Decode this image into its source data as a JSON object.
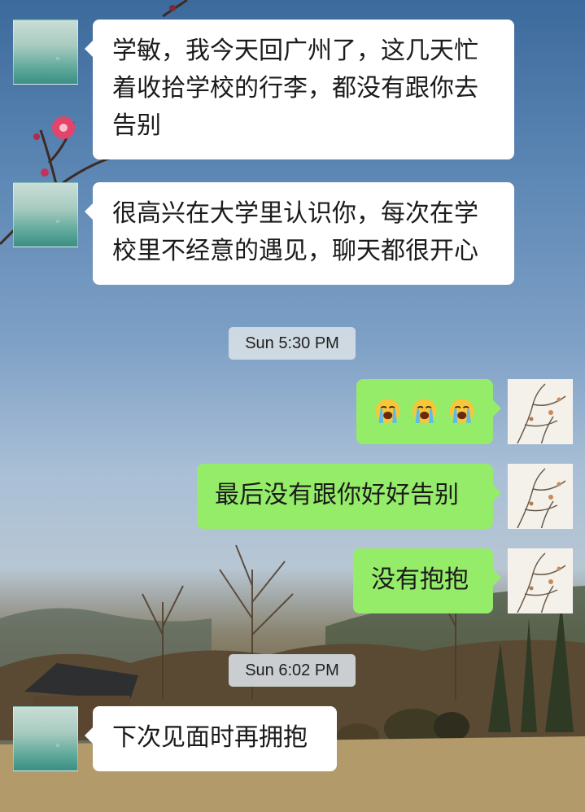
{
  "chat": {
    "messages": [
      {
        "side": "left",
        "text": "学敏，我今天回广州了，这几天忙着收拾学校的行李，都没有跟你去告别"
      },
      {
        "side": "left",
        "text": "很高兴在大学里认识你，每次在学校里不经意的遇见，聊天都很开心"
      },
      {
        "type": "timestamp",
        "text": "Sun 5:30 PM"
      },
      {
        "side": "right",
        "emoji": [
          "loudly-crying-face",
          "loudly-crying-face",
          "loudly-crying-face"
        ]
      },
      {
        "side": "right",
        "text": "最后没有跟你好好告别"
      },
      {
        "side": "right",
        "text": "没有抱抱"
      },
      {
        "type": "timestamp",
        "text": "Sun 6:02 PM"
      },
      {
        "side": "left",
        "text": "下次见面时再拥抱"
      }
    ]
  },
  "lines": {
    "m0_1": "学敏，我今天回广州了，这几天忙",
    "m0_2": "着收拾学校的行李，都没有跟你去",
    "m0_3": "告别",
    "m1_1": "很高兴在大学里认识你，每次在学",
    "m1_2": "校里不经意的遇见，聊天都很开心"
  },
  "colors": {
    "left_bubble": "#ffffff",
    "right_bubble": "#95ec69",
    "timestamp_bg": "#dae0e6"
  }
}
